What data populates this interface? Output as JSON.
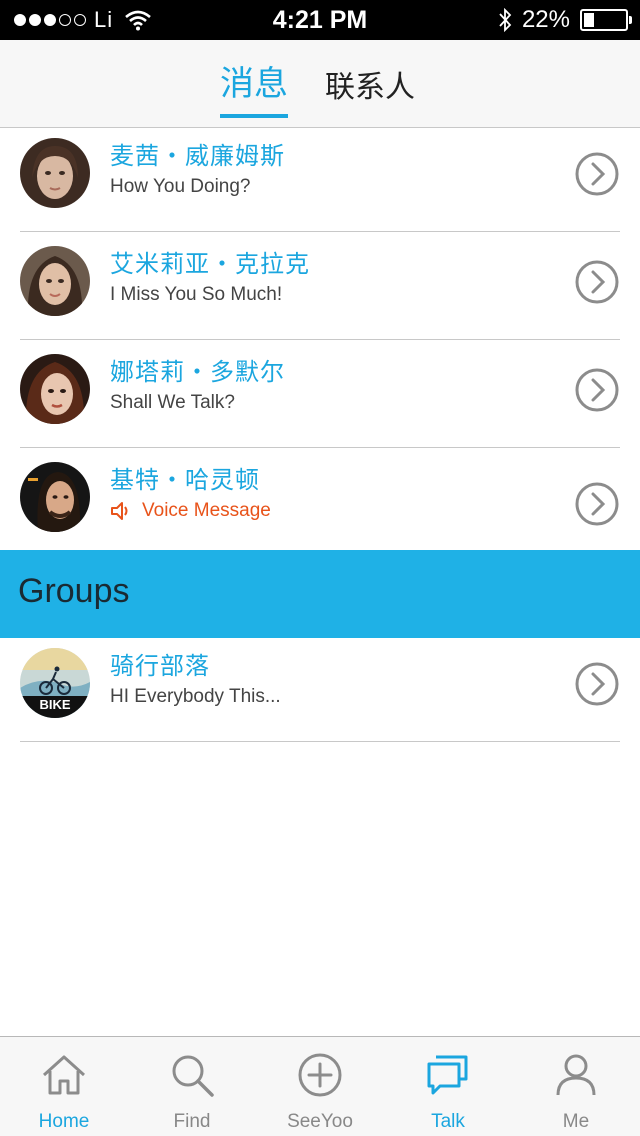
{
  "status_bar": {
    "carrier": "Li",
    "time": "4:21 PM",
    "battery_percent": "22%",
    "battery_level": 0.22
  },
  "top_tabs": {
    "messages": "消息",
    "contacts": "联系人"
  },
  "conversations": [
    {
      "name": "麦茜・威廉姆斯",
      "message": "How You Doing?",
      "avatar": "portrait-avatar-1"
    },
    {
      "name": "艾米莉亚・克拉克",
      "message": "I Miss You So Much!",
      "avatar": "portrait-avatar-2"
    },
    {
      "name": "娜塔莉・多默尔",
      "message": "Shall We Talk?",
      "avatar": "portrait-avatar-3"
    },
    {
      "name": "基特・哈灵顿",
      "message": "Voice Message",
      "avatar": "portrait-avatar-4",
      "message_type": "voice"
    }
  ],
  "groups": {
    "title": "Groups",
    "items": [
      {
        "name": "骑行部落",
        "message": "HI Everybody This...",
        "avatar_text": "BIKE"
      }
    ]
  },
  "tab_bar": {
    "items": [
      {
        "label": "Home",
        "icon": "home-icon",
        "highlight": true
      },
      {
        "label": "Find",
        "icon": "search-icon"
      },
      {
        "label": "SeeYoo",
        "icon": "plus-circle-icon"
      },
      {
        "label": "Talk",
        "icon": "chat-icon",
        "active": true
      },
      {
        "label": "Me",
        "icon": "person-icon"
      }
    ]
  },
  "colors": {
    "accent": "#1ba6df",
    "groups_bar": "#1fb1e6",
    "voice": "#e8531a"
  }
}
